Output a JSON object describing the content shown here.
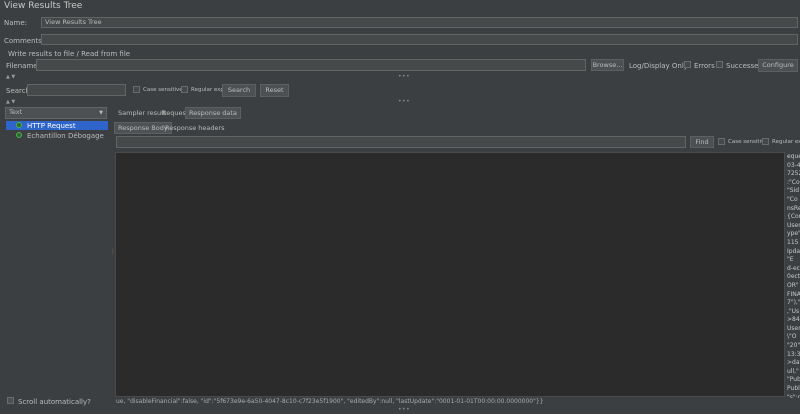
{
  "window": {
    "title": "View Results Tree"
  },
  "form": {
    "name_label": "Name:",
    "name_value": "View Results Tree",
    "comments_label": "Comments:",
    "comments_value": ""
  },
  "file_section": {
    "title": "Write results to file / Read from file",
    "filename_label": "Filename",
    "filename_value": "",
    "browse_label": "Browse...",
    "log_display_label": "Log/Display Only:",
    "errors_label": "Errors",
    "successes_label": "Successes",
    "configure_label": "Configure"
  },
  "search_bar": {
    "search_label": "Search:",
    "search_value": "",
    "case_sensitive_label": "Case sensitive",
    "regexp_label": "Regular exp.",
    "search_button": "Search",
    "reset_button": "Reset"
  },
  "left_panel": {
    "renderer_selected": "Text",
    "tree_items": [
      {
        "label": "HTTP Request",
        "selected": true
      },
      {
        "label": "Echantillon Débogage",
        "selected": false
      }
    ],
    "scroll_auto_label": "Scroll automatically?"
  },
  "right_panel": {
    "tabs": [
      {
        "label": "Sampler result",
        "selected": false
      },
      {
        "label": "Request",
        "selected": false
      },
      {
        "label": "Response data",
        "selected": true
      }
    ],
    "subtabs": [
      {
        "label": "Response Body",
        "selected": true
      },
      {
        "label": "Response headers",
        "selected": false
      }
    ],
    "find_value": "",
    "find_button": "Find",
    "case_sensitive_label": "Case sensitive",
    "regexp_label": "Regular exp",
    "response_lines": [
      "eque",
      "03-4",
      "7252",
      ":\"Co",
      "\"Sid",
      "\"Co",
      "nsRe",
      "{Con",
      "User,",
      "ype\"",
      "115",
      "Ipda",
      "\"E",
      "d-ec",
      "0ect",
      "OR\"",
      "FINA",
      "7\"),\"",
      ",\"Us",
      ">849",
      "Userl",
      "\\\"O",
      "\"20\",",
      "13:31",
      ">dat",
      "ull,\"",
      "\"Publ",
      "Publi",
      "\"s\":n"
    ],
    "bottom_line": "ue, \"disableFinancial\":false, \"id\":\"5f673e9e-6a50-4047-8c10-c7f23e5f1900\", \"editedBy\":null, \"lastUpdate\":\"0001-01-01T00:00:00.0000000\"}}"
  }
}
